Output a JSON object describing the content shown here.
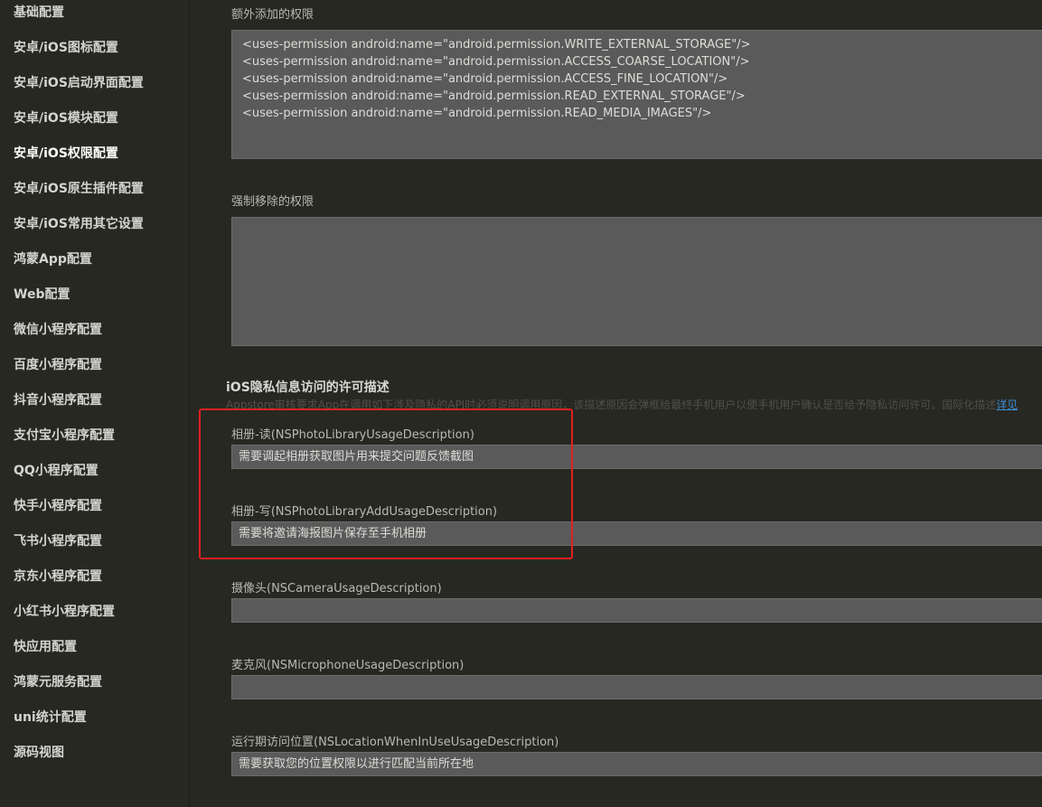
{
  "sidebar": {
    "items": [
      {
        "label": "基础配置"
      },
      {
        "label": "安卓/iOS图标配置"
      },
      {
        "label": "安卓/iOS启动界面配置"
      },
      {
        "label": "安卓/iOS模块配置"
      },
      {
        "label": "安卓/iOS权限配置",
        "active": true
      },
      {
        "label": "安卓/iOS原生插件配置"
      },
      {
        "label": "安卓/iOS常用其它设置"
      },
      {
        "label": "鸿蒙App配置"
      },
      {
        "label": "Web配置"
      },
      {
        "label": "微信小程序配置"
      },
      {
        "label": "百度小程序配置"
      },
      {
        "label": "抖音小程序配置"
      },
      {
        "label": "支付宝小程序配置"
      },
      {
        "label": "QQ小程序配置"
      },
      {
        "label": "快手小程序配置"
      },
      {
        "label": "飞书小程序配置"
      },
      {
        "label": "京东小程序配置"
      },
      {
        "label": "小红书小程序配置"
      },
      {
        "label": "快应用配置"
      },
      {
        "label": "鸿蒙元服务配置"
      },
      {
        "label": "uni统计配置"
      },
      {
        "label": "源码视图"
      }
    ]
  },
  "android": {
    "extra_permissions_label": "额外添加的权限",
    "extra_permissions_value": "<uses-permission android:name=\"android.permission.WRITE_EXTERNAL_STORAGE\"/>\n<uses-permission android:name=\"android.permission.ACCESS_COARSE_LOCATION\"/>\n<uses-permission android:name=\"android.permission.ACCESS_FINE_LOCATION\"/>\n<uses-permission android:name=\"android.permission.READ_EXTERNAL_STORAGE\"/>\n<uses-permission android:name=\"android.permission.READ_MEDIA_IMAGES\"/>",
    "removed_permissions_label": "强制移除的权限",
    "removed_permissions_value": ""
  },
  "ios_privacy": {
    "title": "iOS隐私信息访问的许可描述",
    "description": "Appstore审核要求App在调用如下涉及隐私的API时必须说明调用原因，该描述原因会弹框给最终手机用户以便手机用户确认是否给予隐私访问许可。国际化描述",
    "description_link": "详见",
    "fields": {
      "photo_read": {
        "label": "相册-读(NSPhotoLibraryUsageDescription)",
        "value": "需要调起相册获取图片用来提交问题反馈截图"
      },
      "photo_write": {
        "label": "相册-写(NSPhotoLibraryAddUsageDescription)",
        "value": "需要将邀请海报图片保存至手机相册"
      },
      "camera": {
        "label": "摄像头(NSCameraUsageDescription)",
        "value": ""
      },
      "microphone": {
        "label": "麦克风(NSMicrophoneUsageDescription)",
        "value": ""
      },
      "location_when_in_use": {
        "label": "运行期访问位置(NSLocationWhenInUseUsageDescription)",
        "value": "需要获取您的位置权限以进行匹配当前所在地"
      }
    }
  },
  "colors": {
    "background": "#272822",
    "input_background": "#5a5a5a",
    "highlight_border": "#e02020",
    "link": "#3e8fd6"
  }
}
